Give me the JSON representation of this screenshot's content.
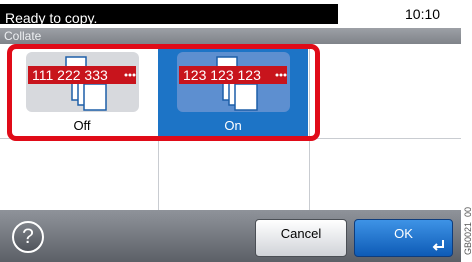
{
  "status": {
    "message": "Ready to copy.",
    "time": "10:10"
  },
  "title": "Collate",
  "options": [
    {
      "label": "Off",
      "illustration_text": "111 222 333",
      "selected": false
    },
    {
      "label": "On",
      "illustration_text": "123 123 123",
      "selected": true
    }
  ],
  "footer": {
    "help_label": "?",
    "cancel_label": "Cancel",
    "ok_label": "OK"
  },
  "side_code": "GB0021_00",
  "colors": {
    "selected": "#1d74c6",
    "highlight": "#e00b18",
    "counter_red": "#c8141c"
  }
}
